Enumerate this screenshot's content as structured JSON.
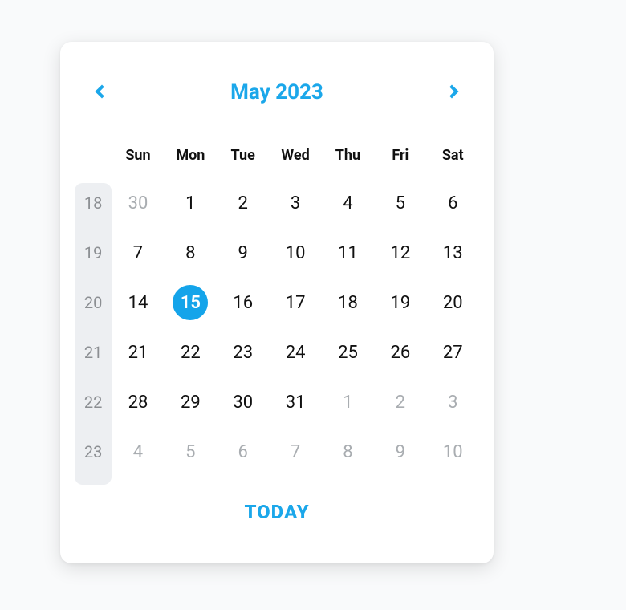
{
  "colors": {
    "accent": "#14a4ea",
    "muted": "#a9adb1",
    "text": "#111111"
  },
  "header": {
    "title": "May 2023",
    "prev_label": "Previous month",
    "next_label": "Next month"
  },
  "weekdays": [
    "Sun",
    "Mon",
    "Tue",
    "Wed",
    "Thu",
    "Fri",
    "Sat"
  ],
  "rows": [
    {
      "week": 18,
      "days": [
        {
          "n": 30,
          "out": true
        },
        {
          "n": 1
        },
        {
          "n": 2
        },
        {
          "n": 3
        },
        {
          "n": 4
        },
        {
          "n": 5
        },
        {
          "n": 6
        }
      ]
    },
    {
      "week": 19,
      "days": [
        {
          "n": 7
        },
        {
          "n": 8
        },
        {
          "n": 9
        },
        {
          "n": 10
        },
        {
          "n": 11
        },
        {
          "n": 12
        },
        {
          "n": 13
        }
      ]
    },
    {
      "week": 20,
      "days": [
        {
          "n": 14
        },
        {
          "n": 15,
          "selected": true
        },
        {
          "n": 16
        },
        {
          "n": 17
        },
        {
          "n": 18
        },
        {
          "n": 19
        },
        {
          "n": 20
        }
      ]
    },
    {
      "week": 21,
      "days": [
        {
          "n": 21
        },
        {
          "n": 22
        },
        {
          "n": 23
        },
        {
          "n": 24
        },
        {
          "n": 25
        },
        {
          "n": 26
        },
        {
          "n": 27
        }
      ]
    },
    {
      "week": 22,
      "days": [
        {
          "n": 28
        },
        {
          "n": 29
        },
        {
          "n": 30
        },
        {
          "n": 31
        },
        {
          "n": 1,
          "out": true
        },
        {
          "n": 2,
          "out": true
        },
        {
          "n": 3,
          "out": true
        }
      ]
    },
    {
      "week": 23,
      "days": [
        {
          "n": 4,
          "out": true
        },
        {
          "n": 5,
          "out": true
        },
        {
          "n": 6,
          "out": true
        },
        {
          "n": 7,
          "out": true
        },
        {
          "n": 8,
          "out": true
        },
        {
          "n": 9,
          "out": true
        },
        {
          "n": 10,
          "out": true
        }
      ]
    }
  ],
  "footer": {
    "today_label": "TODAY"
  }
}
